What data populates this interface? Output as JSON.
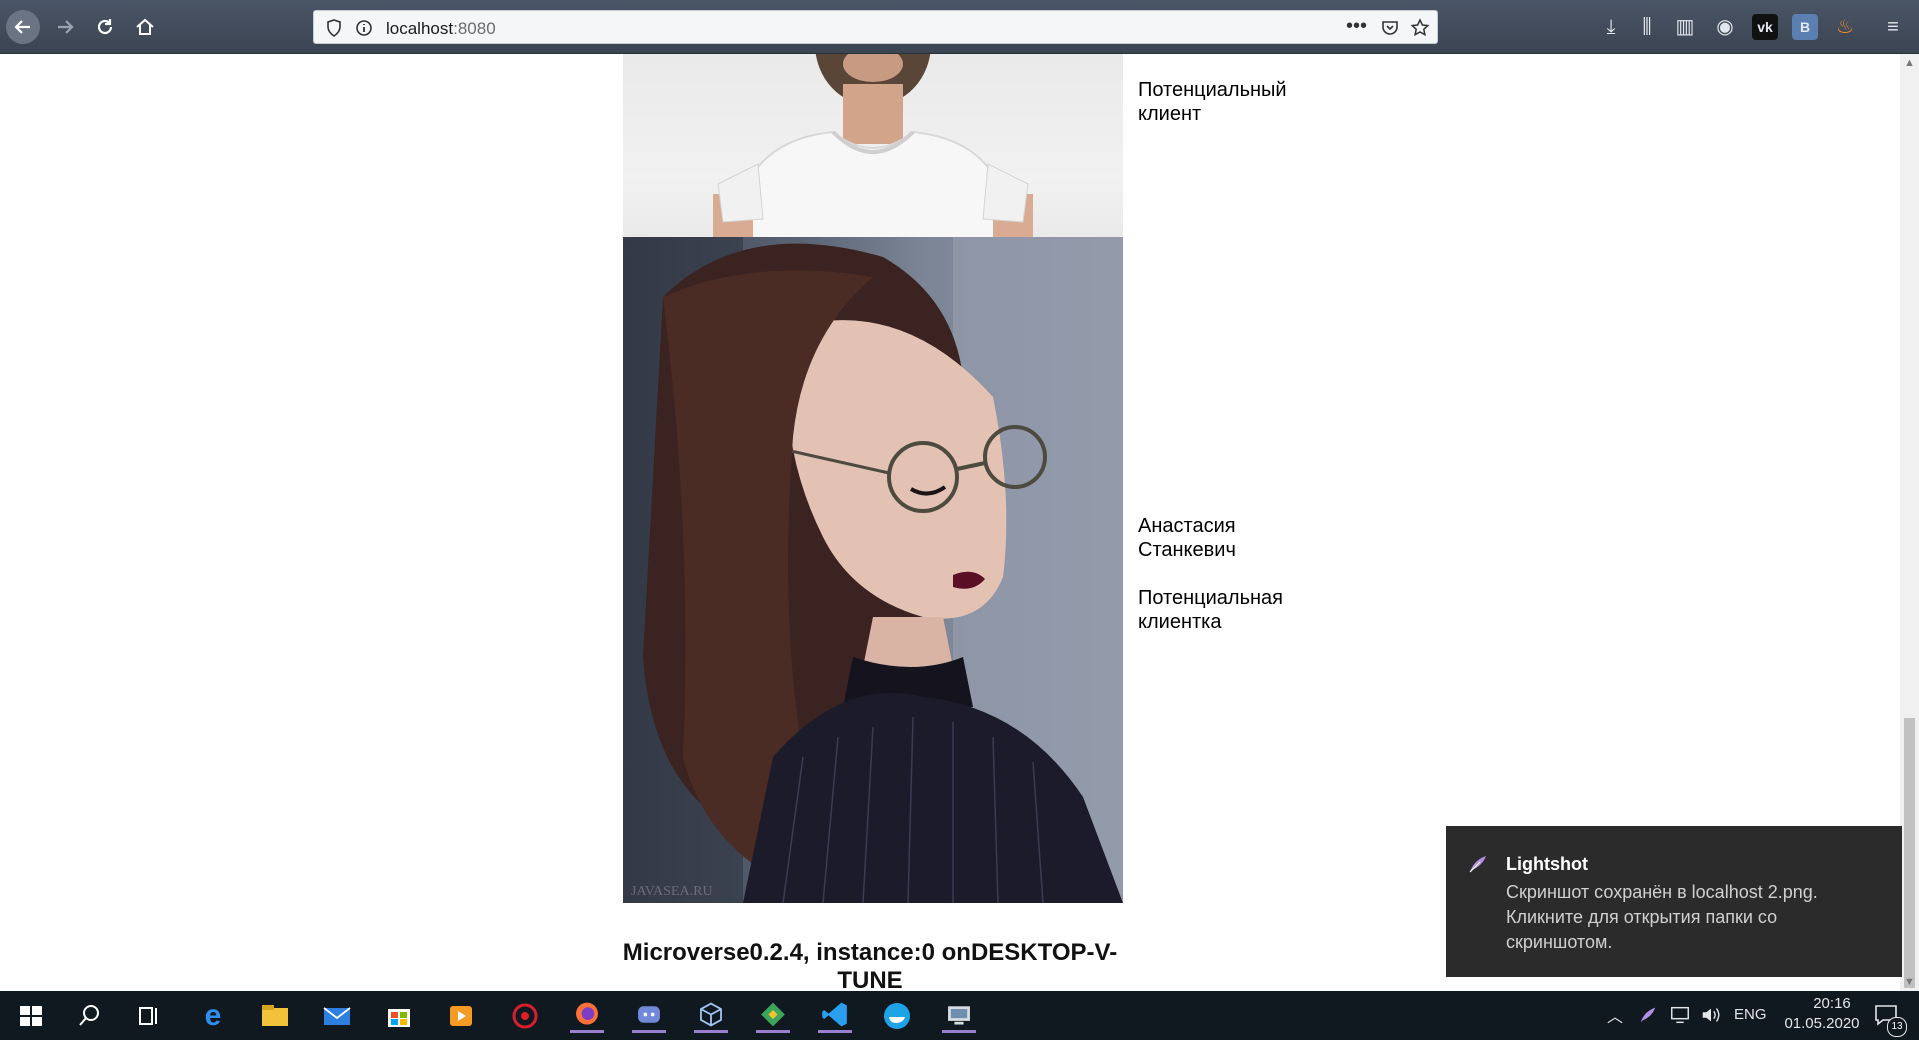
{
  "browser": {
    "url_host": "localhost",
    "url_port": ":8080"
  },
  "page": {
    "cards": [
      {
        "name": "",
        "role": "Потенциальный клиент"
      },
      {
        "name": "Анастасия Станкевич",
        "role": "Потенциальная клиентка"
      }
    ],
    "watermark": "JAVASEA.RU",
    "footer": "Microverse0.2.4, instance:0 onDESKTOP-V-TUNE"
  },
  "notification": {
    "app": "Lightshot",
    "body": "Скриншот сохранён в localhost 2.png. Кликните для открытия папки со скриншотом."
  },
  "taskbar": {
    "lang": "ENG",
    "time": "20:16",
    "date": "01.05.2020",
    "notif_count": "13"
  },
  "colors": {
    "toolbar": "#3b4452",
    "taskbar": "#101820",
    "toast": "#2b2b2b",
    "accent": "#9a7fd0"
  }
}
